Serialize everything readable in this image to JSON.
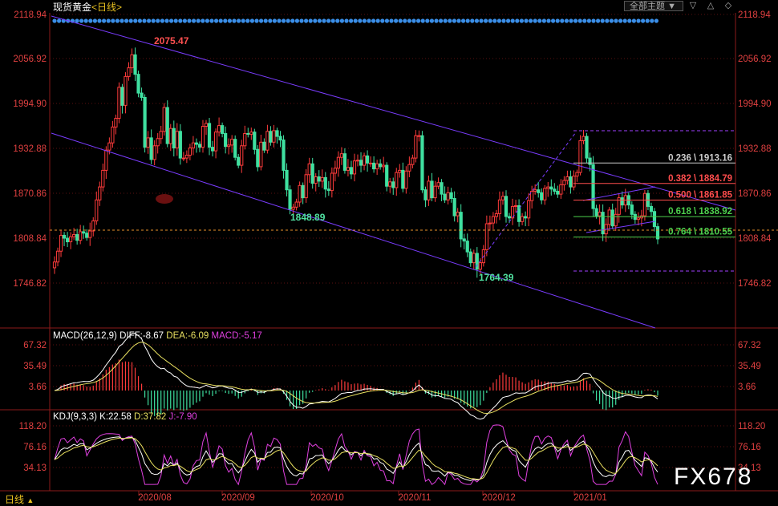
{
  "header": {
    "title": "现货黄金",
    "period": "<日线>",
    "theme_button": "全部主题",
    "dropdown_icon": "chevron-down-icon",
    "down_icon": "arrow-down-icon",
    "up_icon": "arrow-up-icon",
    "more_icon": "more-icon"
  },
  "price_axis": {
    "ticks": [
      "2118.94",
      "2056.92",
      "1994.90",
      "1932.88",
      "1870.86",
      "1808.84",
      "1746.82"
    ]
  },
  "macd": {
    "label": "MACD(26,12,9)",
    "diff": "DIFF:-8.67",
    "dea": "DEA:-6.09",
    "macd": "MACD:-5.17",
    "ticks": [
      "67.32",
      "35.49",
      "3.66"
    ]
  },
  "kdj": {
    "label": "KDJ(9,3,3)",
    "k": "K:22.58",
    "d": "D:37.82",
    "j": "J:-7.90",
    "ticks": [
      "118.20",
      "76.16",
      "34.13"
    ]
  },
  "x_axis": {
    "labels": [
      "2020/08",
      "2020/09",
      "2020/10",
      "2020/11",
      "2020/12",
      "2021/01"
    ]
  },
  "footer": {
    "period": "日线",
    "watermark": "FX678"
  },
  "annotations": {
    "high": "2075.47",
    "low1": "1848.89",
    "low2": "1764.39"
  },
  "fib": [
    {
      "label": "0.236 \\ 1913.16",
      "color": "#cccccc",
      "price": 1913.16
    },
    {
      "label": "0.382 \\ 1884.79",
      "color": "#ff4d4d",
      "price": 1884.79
    },
    {
      "label": "0.500 \\ 1861.85",
      "color": "#ff4d4d",
      "price": 1861.85
    },
    {
      "label": "0.618 \\ 1838.92",
      "color": "#4dd04d",
      "price": 1838.92
    },
    {
      "label": "0.764 \\ 1810.55",
      "color": "#4dd04d",
      "price": 1810.55
    }
  ],
  "chart_data": {
    "type": "candlestick",
    "symbol": "现货黄金",
    "period": "日线",
    "price_range": [
      1746.82,
      2118.94
    ],
    "close": [
      1776,
      1791,
      1813,
      1809,
      1804,
      1811,
      1814,
      1806,
      1818,
      1816,
      1810,
      1819,
      1833,
      1862,
      1880,
      1903,
      1931,
      1941,
      1963,
      1975,
      2018,
      1993,
      2033,
      2045,
      2063,
      2036,
      2010,
      2004,
      1935,
      1948,
      1918,
      1937,
      1947,
      1957,
      1990,
      1940,
      1961,
      1934,
      1957,
      1920,
      1920,
      1924,
      1934,
      1941,
      1939,
      1935,
      1964,
      1968,
      1935,
      1930,
      1956,
      1965,
      1954,
      1936,
      1938,
      1946,
      1921,
      1910,
      1937,
      1954,
      1953,
      1956,
      1932,
      1908,
      1942,
      1931,
      1957,
      1942,
      1958,
      1950,
      1945,
      1903,
      1876,
      1849,
      1852,
      1859,
      1882,
      1865,
      1897,
      1912,
      1885,
      1894,
      1888,
      1893,
      1877,
      1875,
      1899,
      1906,
      1921,
      1926,
      1903,
      1907,
      1898,
      1916,
      1917,
      1910,
      1923,
      1913,
      1913,
      1905,
      1912,
      1908,
      1910,
      1881,
      1887,
      1879,
      1900,
      1903,
      1878,
      1902,
      1911,
      1920,
      1951,
      1951,
      1876,
      1862,
      1888,
      1865,
      1881,
      1886,
      1870,
      1862,
      1872,
      1864,
      1840,
      1845,
      1808,
      1805,
      1790,
      1775,
      1788,
      1766,
      1775,
      1793,
      1829,
      1830,
      1839,
      1843,
      1862,
      1867,
      1839,
      1837,
      1853,
      1854,
      1832,
      1839,
      1837,
      1861,
      1874,
      1876,
      1872,
      1862,
      1878,
      1880,
      1877,
      1874,
      1870,
      1883,
      1889,
      1894,
      1880,
      1895,
      1900,
      1944,
      1950,
      1920,
      1911,
      1850,
      1840,
      1845,
      1815,
      1828,
      1848,
      1826,
      1842,
      1865,
      1855,
      1868,
      1855,
      1842,
      1835,
      1837,
      1840,
      1871,
      1853,
      1846,
      1825,
      1808
    ],
    "open_high": 2075.47,
    "swing_lows": [
      1848.89,
      1764.39
    ],
    "fibonacci": {
      "0.236": 1913.16,
      "0.382": 1884.79,
      "0.500": 1861.85,
      "0.618": 1838.92,
      "0.764": 1810.55
    },
    "x_labels": [
      "2020/08",
      "2020/09",
      "2020/10",
      "2020/11",
      "2020/12",
      "2021/01"
    ],
    "macd": {
      "DIFF": -8.67,
      "DEA": -6.09,
      "MACD": -5.17
    },
    "kdj": {
      "K": 22.58,
      "D": 37.82,
      "J": -7.9
    }
  }
}
